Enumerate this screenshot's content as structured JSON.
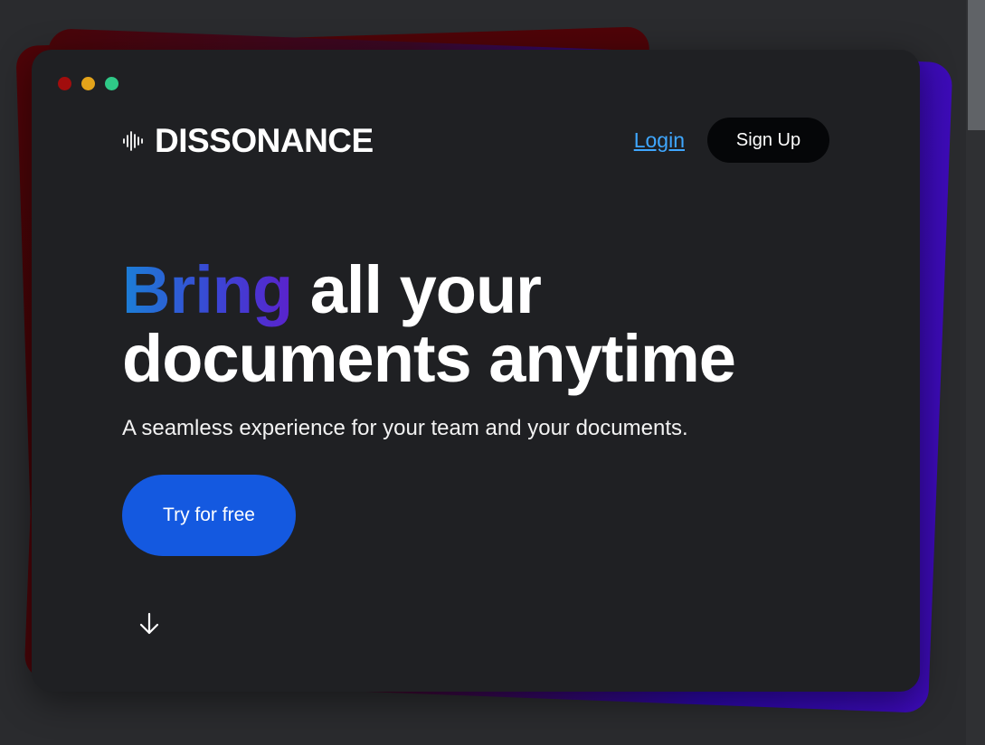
{
  "window": {
    "controls": [
      "close",
      "minimize",
      "maximize"
    ]
  },
  "header": {
    "brand_icon": "soundwave-icon",
    "brand_name": "DISSONANCE",
    "login_label": "Login",
    "signup_label": "Sign Up"
  },
  "hero": {
    "title_accent": "Bring",
    "title_rest_line1": " all your",
    "title_line2": "documents anytime",
    "subtitle": "A seamless experience for your team and your documents.",
    "cta_label": "Try for free",
    "scroll_icon": "arrow-down-icon"
  },
  "colors": {
    "background": "#2a2b2e",
    "window": "#1f2023",
    "accent_blue": "#1459e0",
    "link_blue": "#3fa7ff",
    "title_gradient_start": "#1b7fd6",
    "title_gradient_end": "#5a22cc",
    "dot_red": "#a10d0d",
    "dot_yellow": "#e3a31a",
    "dot_green": "#2fc987"
  }
}
